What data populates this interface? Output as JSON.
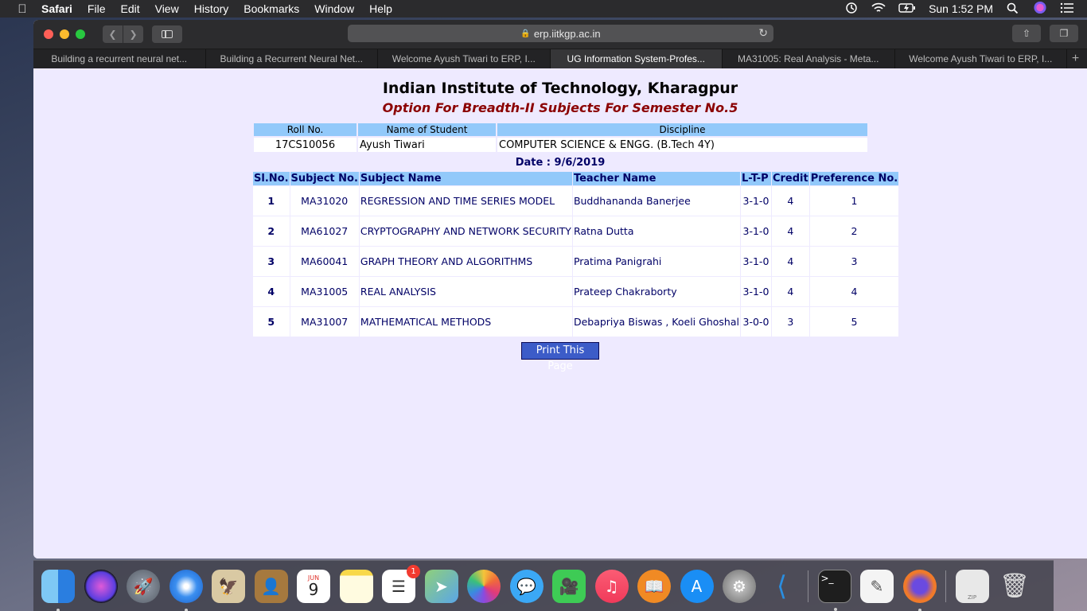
{
  "menubar": {
    "app_name": "Safari",
    "items": [
      "File",
      "Edit",
      "View",
      "History",
      "Bookmarks",
      "Window",
      "Help"
    ],
    "clock": "Sun 1:52 PM"
  },
  "browser": {
    "url": "erp.iitkgp.ac.in",
    "tabs": [
      {
        "label": "Building a recurrent neural net..."
      },
      {
        "label": "Building a Recurrent Neural Net..."
      },
      {
        "label": "Welcome Ayush Tiwari to ERP, I..."
      },
      {
        "label": "UG Information System-Profes..."
      },
      {
        "label": "MA31005: Real Analysis - Meta..."
      },
      {
        "label": "Welcome Ayush Tiwari to ERP, I..."
      }
    ],
    "new_tab_label": "+"
  },
  "page": {
    "institute": "Indian Institute of Technology, Kharagpur",
    "subtitle": "Option For Breadth-II Subjects For Semester No.5",
    "info_headers": {
      "roll": "Roll No.",
      "name": "Name of Student",
      "discipline": "Discipline"
    },
    "student": {
      "roll": "17CS10056",
      "name": "Ayush Tiwari",
      "discipline": "COMPUTER SCIENCE & ENGG. (B.Tech 4Y)"
    },
    "date": "Date : 9/6/2019",
    "headers": {
      "slno": "Sl.No.",
      "subject_no": "Subject No.",
      "subject_name": "Subject Name",
      "teacher": "Teacher Name",
      "ltp": "L-T-P",
      "credit": "Credit",
      "pref": "Preference No."
    },
    "rows": [
      {
        "slno": "1",
        "subject_no": "MA31020",
        "subject_name": "REGRESSION AND TIME SERIES MODEL",
        "teacher": "Buddhananda Banerjee",
        "ltp": "3-1-0",
        "credit": "4",
        "pref": "1"
      },
      {
        "slno": "2",
        "subject_no": "MA61027",
        "subject_name": "CRYPTOGRAPHY AND NETWORK SECURITY",
        "teacher": "Ratna Dutta",
        "ltp": "3-1-0",
        "credit": "4",
        "pref": "2"
      },
      {
        "slno": "3",
        "subject_no": "MA60041",
        "subject_name": "GRAPH THEORY AND ALGORITHMS",
        "teacher": "Pratima Panigrahi",
        "ltp": "3-1-0",
        "credit": "4",
        "pref": "3"
      },
      {
        "slno": "4",
        "subject_no": "MA31005",
        "subject_name": "REAL ANALYSIS",
        "teacher": "Prateep Chakraborty",
        "ltp": "3-1-0",
        "credit": "4",
        "pref": "4"
      },
      {
        "slno": "5",
        "subject_no": "MA31007",
        "subject_name": "MATHEMATICAL METHODS",
        "teacher": "Debapriya Biswas , Koeli Ghoshal",
        "ltp": "3-0-0",
        "credit": "3",
        "pref": "5"
      }
    ],
    "print_label": "Print This Page"
  },
  "dock": {
    "calendar_month": "JUN",
    "calendar_day": "9",
    "reminders_badge": "1",
    "archive_label": "ZIP"
  }
}
